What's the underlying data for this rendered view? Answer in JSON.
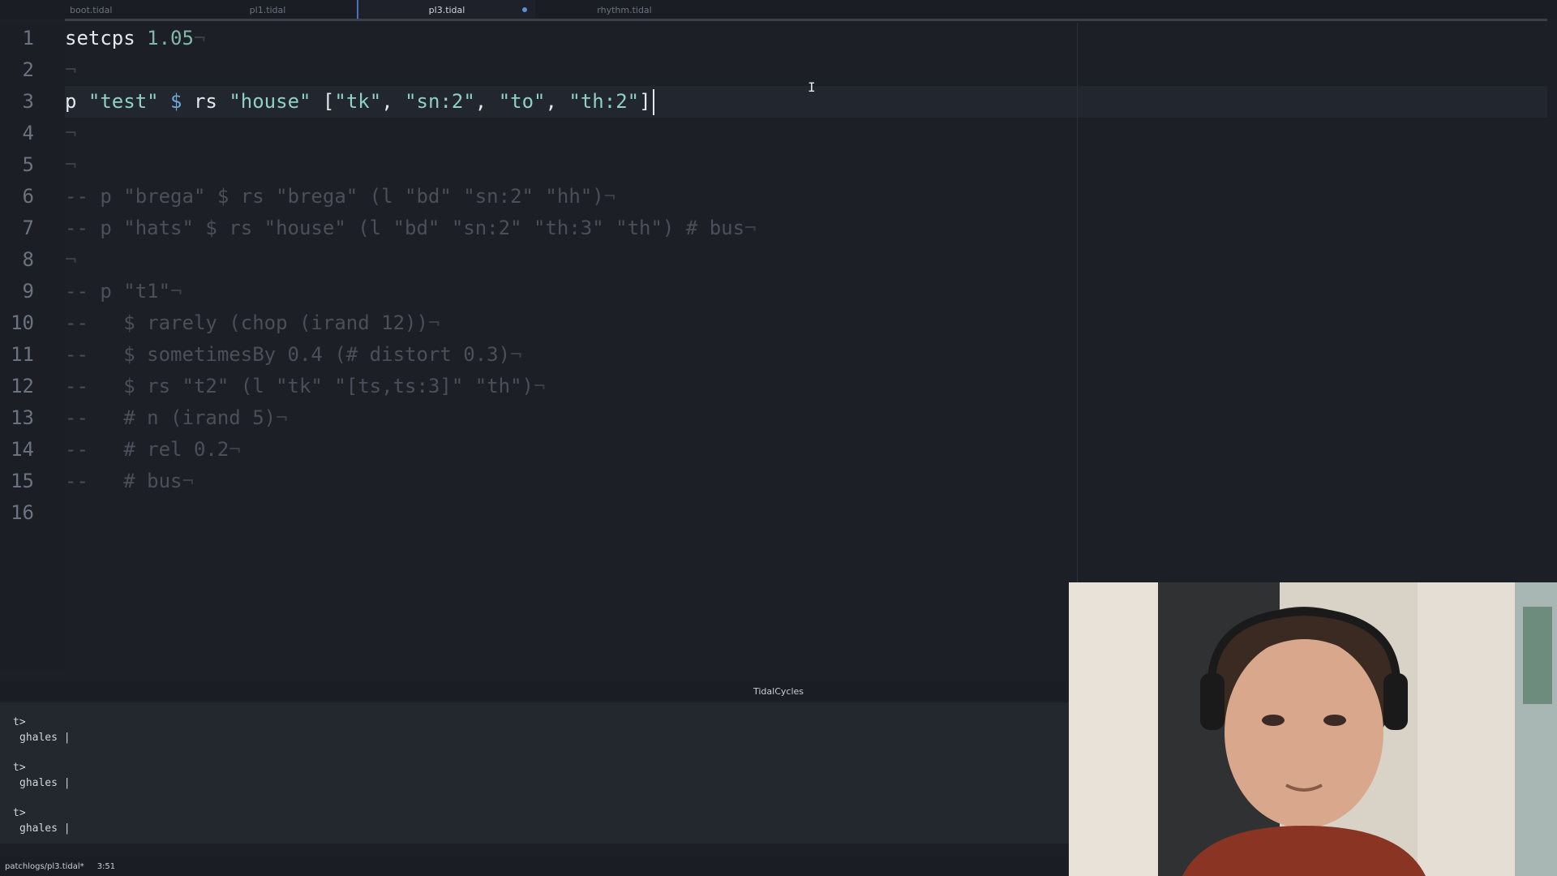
{
  "tabs": [
    {
      "label": "boot.tidal",
      "active": false,
      "dirty": false
    },
    {
      "label": "pl1.tidal",
      "active": false,
      "dirty": false
    },
    {
      "label": "pl3.tidal",
      "active": true,
      "dirty": true
    },
    {
      "label": "rhythm.tidal",
      "active": false,
      "dirty": false
    }
  ],
  "editor": {
    "line_numbers": [
      "1",
      "2",
      "3",
      "4",
      "5",
      "6",
      "7",
      "8",
      "9",
      "10",
      "11",
      "12",
      "13",
      "14",
      "15",
      "16"
    ],
    "eol_marker": "¬",
    "line1": {
      "kw": "setcps ",
      "num": "1.05"
    },
    "line3": {
      "p": "p ",
      "name": "\"test\"",
      "op": " $ ",
      "fn": "rs ",
      "arg": "\"house\"",
      "lb": " [",
      "s1": "\"tk\"",
      "c1": ", ",
      "s2": "\"sn:2\"",
      "c2": ", ",
      "s3": "\"to\"",
      "c3": ", ",
      "s4": "\"th:2\"",
      "rb": "]"
    },
    "line6": "-- p \"brega\" $ rs \"brega\" (l \"bd\" \"sn:2\" \"hh\")",
    "line7": "-- p \"hats\" $ rs \"house\" (l \"bd\" \"sn:2\" \"th:3\" \"th\") # bus",
    "line9": "-- p \"t1\"",
    "line10": "--   $ rarely (chop (irand 12))",
    "line11": "--   $ sometimesBy 0.4 (# distort 0.3)",
    "line12": "--   $ rs \"t2\" (l \"tk\" \"[ts,ts:3]\" \"th\")",
    "line13": "--   # n (irand 5)",
    "line14": "--   # rel 0.2",
    "line15": "--   # bus"
  },
  "console": {
    "title": "TidalCycles",
    "entries": [
      {
        "prompt": "t>",
        "output": "ghales |"
      },
      {
        "prompt": "t>",
        "output": "ghales |"
      },
      {
        "prompt": "t>",
        "output": "ghales |"
      }
    ]
  },
  "statusbar": {
    "file_path": "patchlogs/pl3.tidal*",
    "cursor_pos": "3:51"
  },
  "colors": {
    "background": "#1c1f26",
    "accent": "#5b8fd8",
    "string": "#8fd1c3",
    "comment": "#4a4f5a"
  }
}
